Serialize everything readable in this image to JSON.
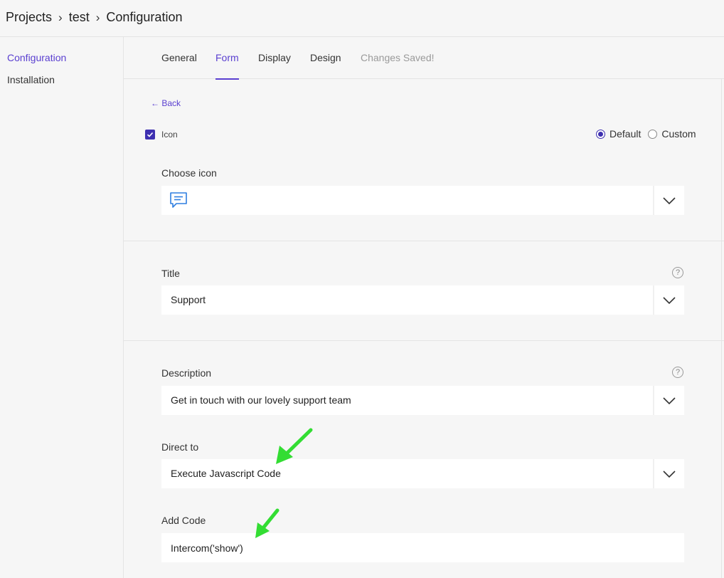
{
  "breadcrumb": {
    "items": [
      "Projects",
      "test",
      "Configuration"
    ]
  },
  "sidebar": {
    "items": [
      {
        "label": "Configuration",
        "active": true
      },
      {
        "label": "Installation",
        "active": false
      }
    ]
  },
  "tabs": [
    {
      "label": "General",
      "state": "normal"
    },
    {
      "label": "Form",
      "state": "active"
    },
    {
      "label": "Display",
      "state": "normal"
    },
    {
      "label": "Design",
      "state": "normal"
    },
    {
      "label": "Changes Saved!",
      "state": "muted"
    }
  ],
  "form": {
    "back_label": "← Back",
    "icon_checkbox": {
      "label": "Icon",
      "checked": true
    },
    "icon_mode": {
      "options": [
        "Default",
        "Custom"
      ],
      "selected": "Default"
    },
    "choose_icon": {
      "label": "Choose icon",
      "icon": "chat-bubble-icon"
    },
    "title": {
      "label": "Title",
      "value": "Support"
    },
    "description": {
      "label": "Description",
      "value": "Get in touch with our lovely support team"
    },
    "direct_to": {
      "label": "Direct to",
      "value": "Execute Javascript Code"
    },
    "add_code": {
      "label": "Add Code",
      "value": "Intercom('show')"
    }
  },
  "colors": {
    "accent": "#5a3fd0",
    "checkbox": "#3d2fb0",
    "annotation_arrow": "#33dd33",
    "icon_blue": "#2f7fe0"
  }
}
